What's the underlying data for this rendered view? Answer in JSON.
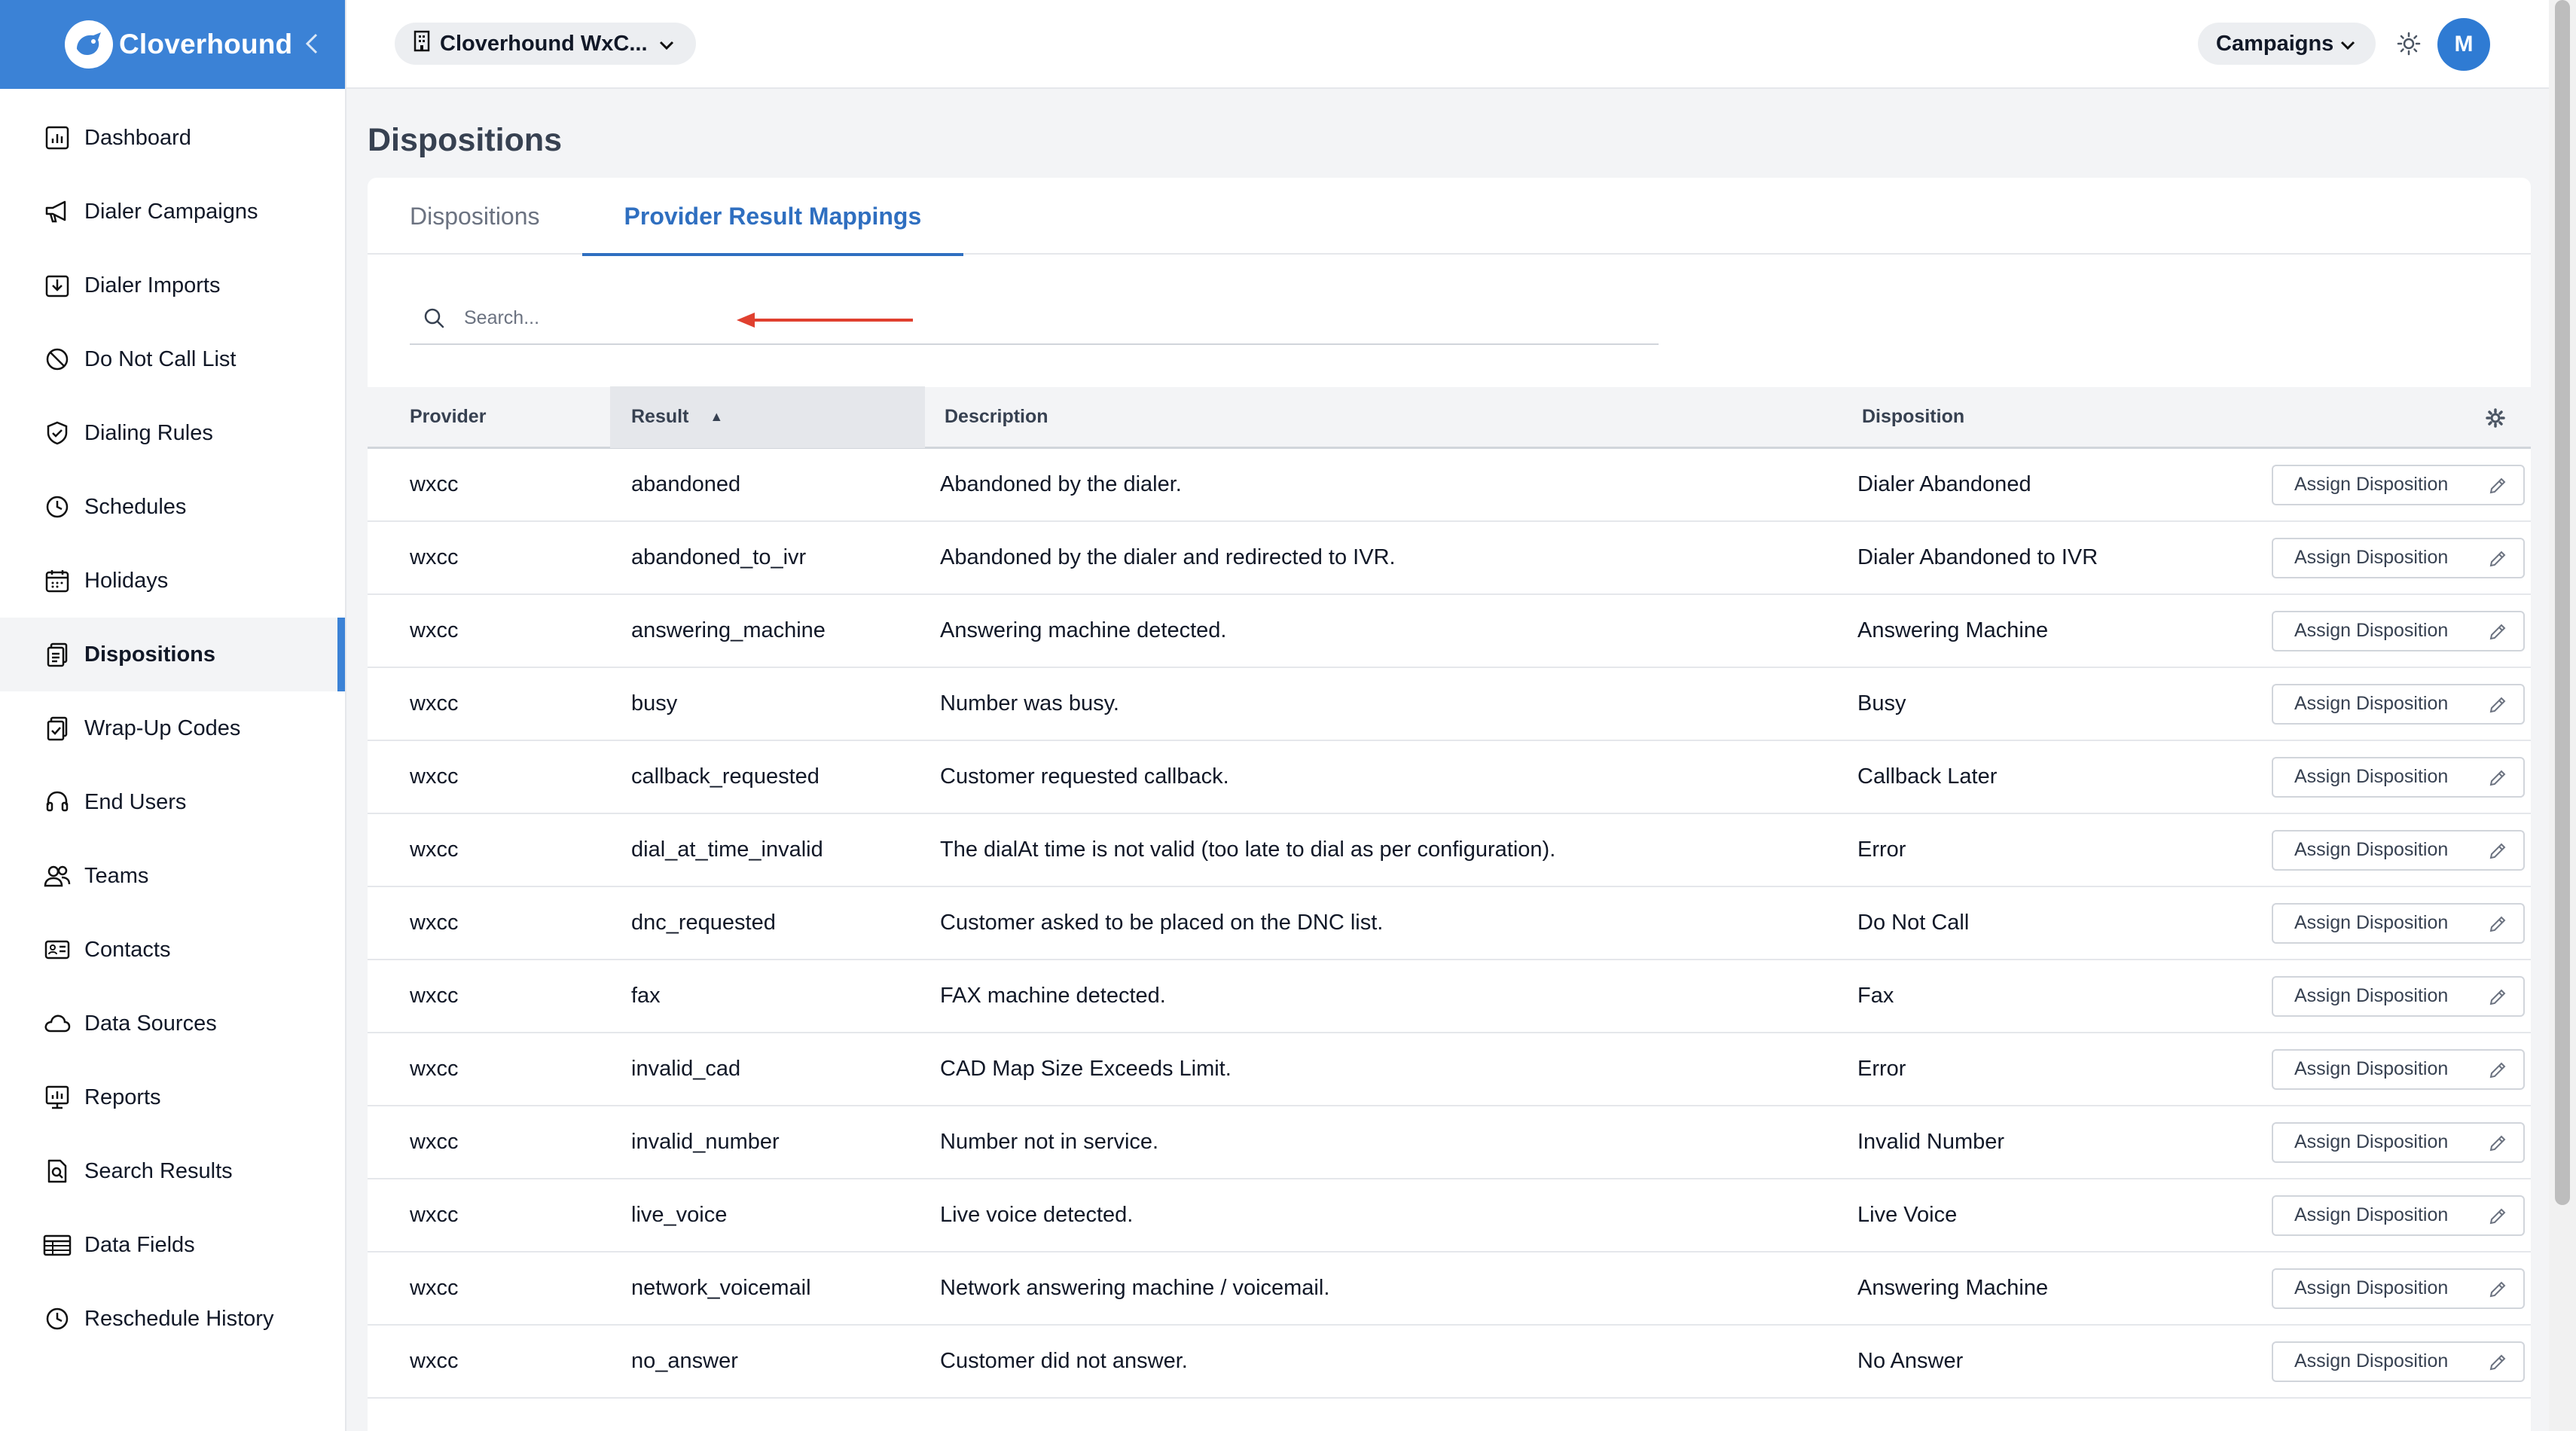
{
  "brand": {
    "name": "Cloverhound"
  },
  "sidebar": {
    "items": [
      {
        "label": "Dashboard",
        "icon": "chart-icon",
        "active": false
      },
      {
        "label": "Dialer Campaigns",
        "icon": "megaphone-icon",
        "active": false
      },
      {
        "label": "Dialer Imports",
        "icon": "import-icon",
        "active": false
      },
      {
        "label": "Do Not Call List",
        "icon": "ban-icon",
        "active": false
      },
      {
        "label": "Dialing Rules",
        "icon": "shield-icon",
        "active": false
      },
      {
        "label": "Schedules",
        "icon": "clock-icon",
        "active": false
      },
      {
        "label": "Holidays",
        "icon": "calendar-icon",
        "active": false
      },
      {
        "label": "Dispositions",
        "icon": "clipboard-icon",
        "active": true
      },
      {
        "label": "Wrap-Up Codes",
        "icon": "clipboard-check-icon",
        "active": false
      },
      {
        "label": "End Users",
        "icon": "headset-icon",
        "active": false
      },
      {
        "label": "Teams",
        "icon": "users-icon",
        "active": false
      },
      {
        "label": "Contacts",
        "icon": "id-card-icon",
        "active": false
      },
      {
        "label": "Data Sources",
        "icon": "cloud-icon",
        "active": false
      },
      {
        "label": "Reports",
        "icon": "report-icon",
        "active": false
      },
      {
        "label": "Search Results",
        "icon": "file-search-icon",
        "active": false
      },
      {
        "label": "Data Fields",
        "icon": "table-icon",
        "active": false
      },
      {
        "label": "Reschedule History",
        "icon": "history-icon",
        "active": false
      }
    ]
  },
  "header": {
    "org_label": "Cloverhound WxC...",
    "campaigns_label": "Campaigns",
    "avatar_initial": "M"
  },
  "page": {
    "title": "Dispositions",
    "tabs": [
      {
        "label": "Dispositions",
        "active": false
      },
      {
        "label": "Provider Result Mappings",
        "active": true
      }
    ],
    "search": {
      "placeholder": "Search...",
      "value": ""
    }
  },
  "table": {
    "columns": [
      "Provider",
      "Result",
      "Description",
      "Disposition"
    ],
    "sorted_column": "Result",
    "sort_direction": "ascending",
    "action_label": "Assign Disposition",
    "rows": [
      {
        "provider": "wxcc",
        "result": "abandoned",
        "description": "Abandoned by the dialer.",
        "disposition": "Dialer Abandoned"
      },
      {
        "provider": "wxcc",
        "result": "abandoned_to_ivr",
        "description": "Abandoned by the dialer and redirected to IVR.",
        "disposition": "Dialer Abandoned to IVR"
      },
      {
        "provider": "wxcc",
        "result": "answering_machine",
        "description": "Answering machine detected.",
        "disposition": "Answering Machine"
      },
      {
        "provider": "wxcc",
        "result": "busy",
        "description": "Number was busy.",
        "disposition": "Busy"
      },
      {
        "provider": "wxcc",
        "result": "callback_requested",
        "description": "Customer requested callback.",
        "disposition": "Callback Later"
      },
      {
        "provider": "wxcc",
        "result": "dial_at_time_invalid",
        "description": "The dialAt time is not valid (too late to dial as per configuration).",
        "disposition": "Error"
      },
      {
        "provider": "wxcc",
        "result": "dnc_requested",
        "description": "Customer asked to be placed on the DNC list.",
        "disposition": "Do Not Call"
      },
      {
        "provider": "wxcc",
        "result": "fax",
        "description": "FAX machine detected.",
        "disposition": "Fax"
      },
      {
        "provider": "wxcc",
        "result": "invalid_cad",
        "description": "CAD Map Size Exceeds Limit.",
        "disposition": "Error"
      },
      {
        "provider": "wxcc",
        "result": "invalid_number",
        "description": "Number not in service.",
        "disposition": "Invalid Number"
      },
      {
        "provider": "wxcc",
        "result": "live_voice",
        "description": "Live voice detected.",
        "disposition": "Live Voice"
      },
      {
        "provider": "wxcc",
        "result": "network_voicemail",
        "description": "Network answering machine / voicemail.",
        "disposition": "Answering Machine"
      },
      {
        "provider": "wxcc",
        "result": "no_answer",
        "description": "Customer did not answer.",
        "disposition": "No Answer"
      }
    ]
  },
  "colors": {
    "brand": "#3b82d6",
    "accent": "#2f6fc0",
    "annotation_arrow": "#e0402f"
  }
}
